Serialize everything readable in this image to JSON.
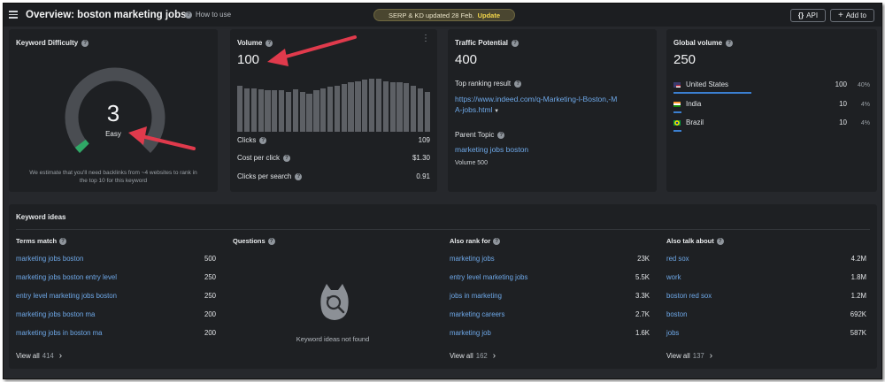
{
  "header": {
    "title": "Overview: boston marketing jobs",
    "help_label": "How to use",
    "notice_text": "SERP & KD updated 28 Feb.",
    "notice_action": "Update",
    "api_label": "API",
    "add_to_label": "Add to"
  },
  "kd": {
    "title": "Keyword Difficulty",
    "score": "3",
    "score_percent": 3,
    "label": "Easy",
    "note": "We estimate that you'll need backlinks from ~4 websites to rank in the top 10 for this keyword"
  },
  "volume": {
    "title": "Volume",
    "value": "100",
    "trend": [
      58,
      55,
      55,
      54,
      53,
      52,
      52,
      50,
      54,
      50,
      48,
      52,
      55,
      57,
      58,
      60,
      62,
      64,
      66,
      67,
      67,
      64,
      63,
      62,
      61,
      58,
      55,
      50
    ],
    "clicks_label": "Clicks",
    "clicks_value": "109",
    "cpc_label": "Cost per click",
    "cpc_value": "$1.30",
    "cps_label": "Clicks per search",
    "cps_value": "0.91"
  },
  "traffic": {
    "title": "Traffic Potential",
    "value": "400",
    "top_result_label": "Top ranking result",
    "top_result_line1": "https://www.indeed.com/q-Marketing-l-Boston,-M",
    "top_result_line2": "A-jobs.html",
    "parent_label": "Parent Topic",
    "parent_link": "marketing jobs boston",
    "parent_volume": "Volume 500"
  },
  "global": {
    "title": "Global volume",
    "value": "250",
    "countries": [
      {
        "name": "United States",
        "value": "100",
        "pct": "40%",
        "share": 40
      },
      {
        "name": "India",
        "value": "10",
        "pct": "4%",
        "share": 4
      },
      {
        "name": "Brazil",
        "value": "10",
        "pct": "4%",
        "share": 4
      }
    ]
  },
  "ideas": {
    "title": "Keyword ideas",
    "empty_text": "Keyword ideas not found",
    "columns": [
      {
        "title": "Terms match",
        "items": [
          {
            "k": "marketing jobs boston",
            "v": "500"
          },
          {
            "k": "marketing jobs boston entry level",
            "v": "250"
          },
          {
            "k": "entry level marketing jobs boston",
            "v": "250"
          },
          {
            "k": "marketing jobs boston ma",
            "v": "200"
          },
          {
            "k": "marketing jobs in boston ma",
            "v": "200"
          }
        ],
        "view_all": "View all",
        "count": "414"
      },
      {
        "title": "Questions",
        "items": [],
        "view_all": "",
        "count": ""
      },
      {
        "title": "Also rank for",
        "items": [
          {
            "k": "marketing jobs",
            "v": "23K"
          },
          {
            "k": "entry level marketing jobs",
            "v": "5.5K"
          },
          {
            "k": "jobs in marketing",
            "v": "3.3K"
          },
          {
            "k": "marketing careers",
            "v": "2.7K"
          },
          {
            "k": "marketing job",
            "v": "1.6K"
          }
        ],
        "view_all": "View all",
        "count": "162"
      },
      {
        "title": "Also talk about",
        "items": [
          {
            "k": "red sox",
            "v": "4.2M"
          },
          {
            "k": "work",
            "v": "1.8M"
          },
          {
            "k": "boston red sox",
            "v": "1.2M"
          },
          {
            "k": "boston",
            "v": "692K"
          },
          {
            "k": "jobs",
            "v": "587K"
          }
        ],
        "view_all": "View all",
        "count": "137"
      }
    ]
  },
  "colors": {
    "link": "#6ea8e8",
    "gauge_track": "#4a4d52",
    "gauge_fill": "#2fa866",
    "annotation_arrow": "#e03a4c",
    "notice_bg": "#4a4630"
  }
}
